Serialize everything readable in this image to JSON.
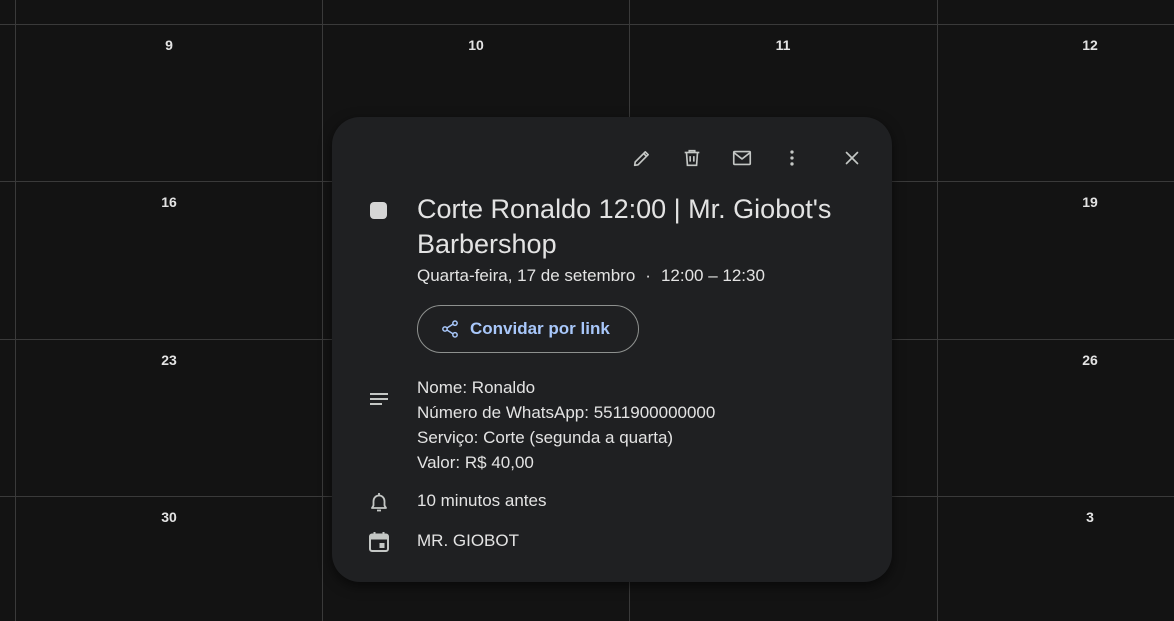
{
  "calendar": {
    "day_numbers": [
      "9",
      "10",
      "11",
      "12",
      "16",
      "19",
      "23",
      "26",
      "30",
      "3"
    ]
  },
  "event": {
    "title": "Corte Ronaldo 12:00 | Mr. Giobot's Barbershop",
    "date": "Quarta-feira, 17 de setembro",
    "separator": "·",
    "time": "12:00 – 12:30",
    "color": "#d5d5d5",
    "invite_label": "Convidar por link",
    "description": [
      "Nome: Ronaldo",
      "Número de WhatsApp: 5511900000000",
      "Serviço: Corte (segunda a quarta)",
      "Valor: R$ 40,00"
    ],
    "reminder": "10 minutos antes",
    "calendar_name": "MR. GIOBOT"
  },
  "icons": {
    "toolbar": [
      "edit-icon",
      "delete-icon",
      "email-icon",
      "more-options-icon",
      "close-icon"
    ],
    "rows": [
      "description-icon",
      "bell-icon",
      "calendar-icon"
    ],
    "invite": "share-icon"
  },
  "colors": {
    "background": "#131313",
    "popup": "#1f2022",
    "accent": "#a8c7fa"
  }
}
